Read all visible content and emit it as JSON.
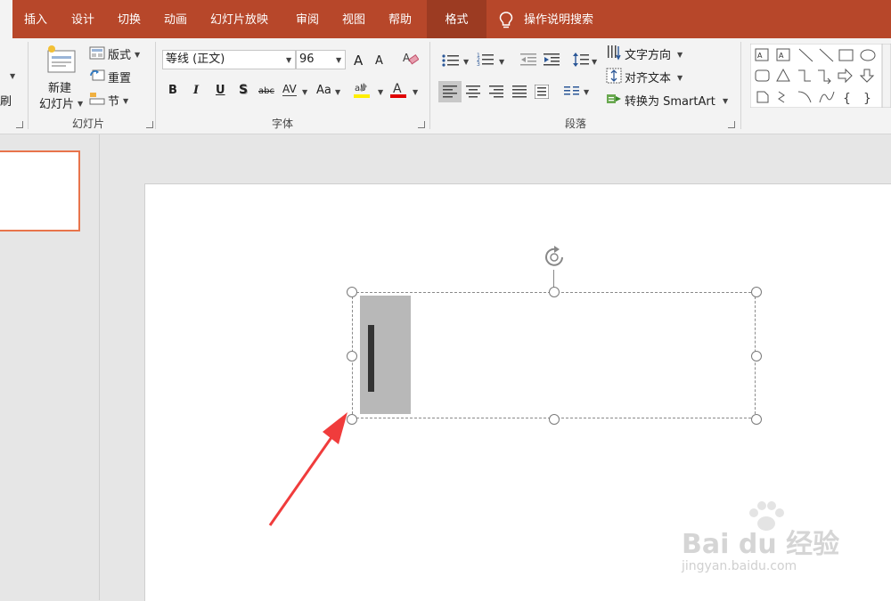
{
  "tabs": [
    "插入",
    "设计",
    "切换",
    "动画",
    "幻灯片放映",
    "审阅",
    "视图",
    "帮助",
    "格式"
  ],
  "tell_me": "操作说明搜索",
  "slides_group": {
    "new_slide_line1": "新建",
    "new_slide_line2": "幻灯片",
    "layout": "版式",
    "reset": "重置",
    "section": "节",
    "label": "幻灯片",
    "left_partial": "刷"
  },
  "font_group": {
    "font_name": "等线 (正文)",
    "font_size": "96",
    "grow": "A",
    "shrink": "A",
    "bold": "B",
    "italic": "I",
    "underline": "U",
    "shadow": "S",
    "strike": "abc",
    "spacing": "AV",
    "case": "Aa",
    "label": "字体"
  },
  "paragraph_group": {
    "text_direction": "文字方向",
    "align_text": "对齐文本",
    "smartart": "转换为 SmartArt",
    "label": "段落"
  },
  "watermark": {
    "brand": "Bai du 经验",
    "url": "jingyan.baidu.com"
  }
}
